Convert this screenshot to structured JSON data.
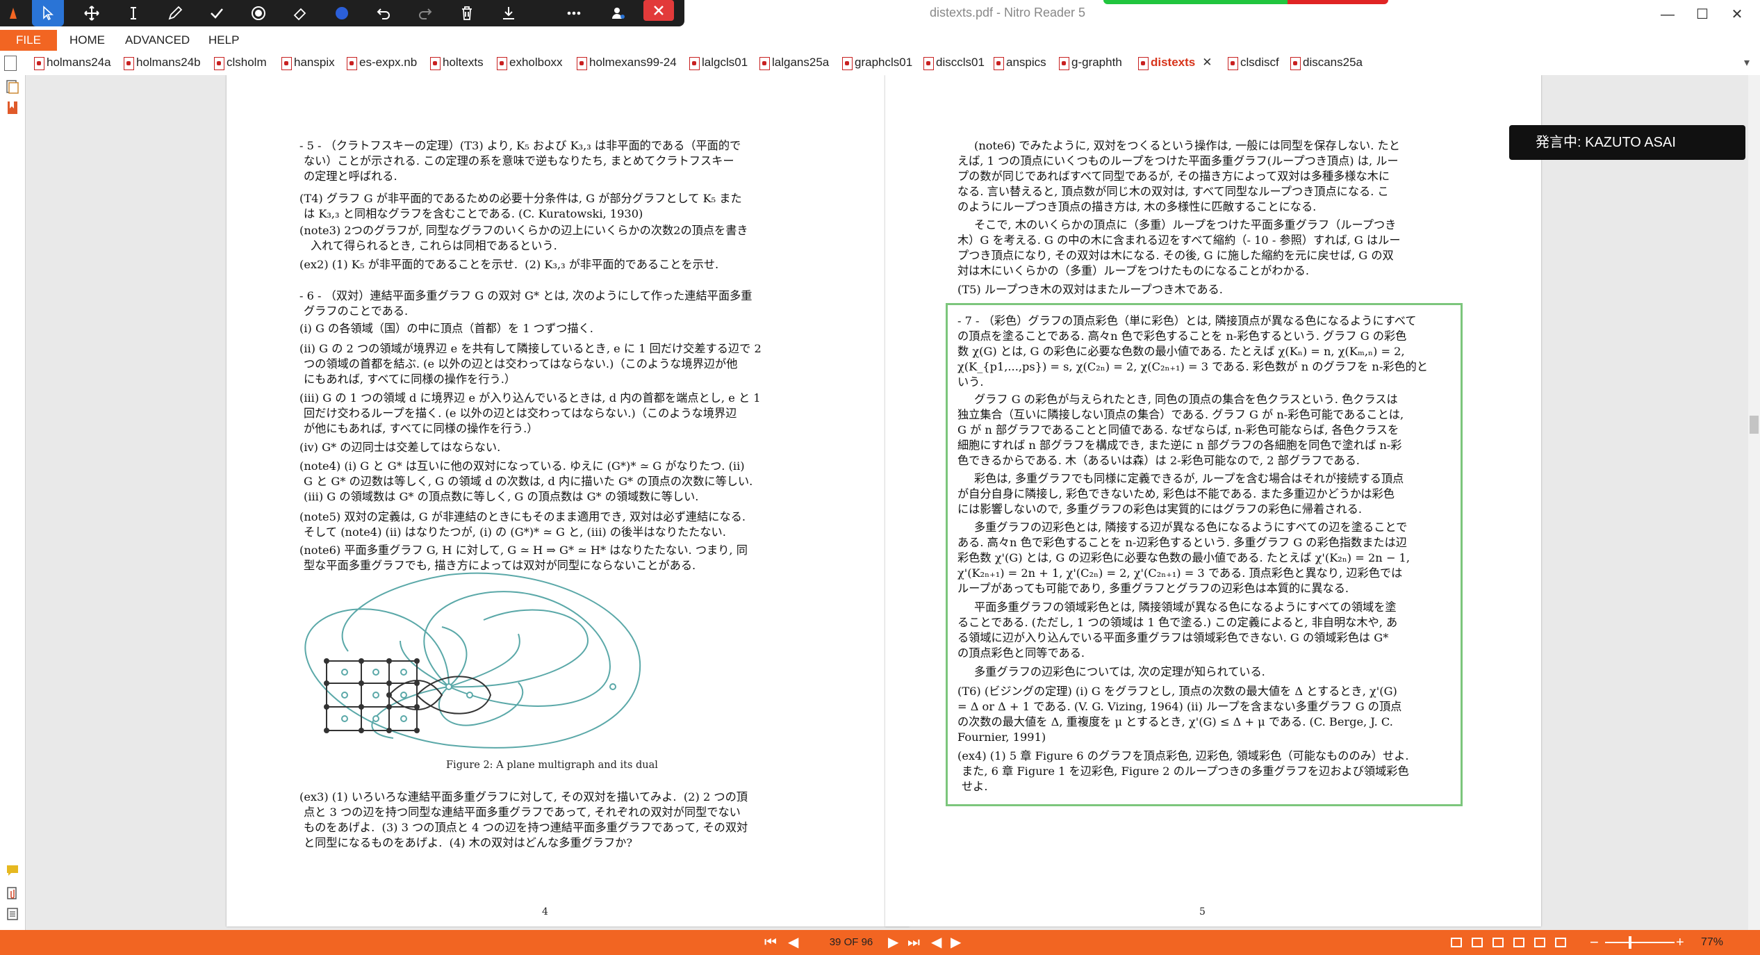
{
  "window": {
    "title": "distexts.pdf - Nitro Reader 5",
    "minimize": "—",
    "maximize": "☐",
    "close": "✕"
  },
  "ribbon": {
    "file": "FILE",
    "home": "HOME",
    "advanced": "ADVANCED",
    "help": "HELP"
  },
  "doc_tabs": [
    {
      "label": "holmans24a"
    },
    {
      "label": "holmans24b"
    },
    {
      "label": "clsholm"
    },
    {
      "label": "hanspix"
    },
    {
      "label": "es-expx.nb"
    },
    {
      "label": "holtexts"
    },
    {
      "label": "exholboxx"
    },
    {
      "label": "holmexans99-24"
    },
    {
      "label": "lalgcls01"
    },
    {
      "label": "lalgans25a"
    },
    {
      "label": "graphcls01"
    },
    {
      "label": "disccls01"
    },
    {
      "label": "anspics"
    },
    {
      "label": "g-graphth"
    },
    {
      "label": "distexts",
      "active": true
    },
    {
      "label": "clsdiscf"
    },
    {
      "label": "discans25a"
    }
  ],
  "speaking_overlay": "発言中: KAZUTO ASAI",
  "page4": {
    "lines": [
      "- 5 - （クラトフスキーの定理）(T3) より, K₅ および K₃,₃ は非平面的である（平面的で",
      "ない）ことが示される. この定理の系を意味で逆もなりたち, まとめてクラトフスキー",
      "の定理と呼ばれる.",
      "(T4) グラフ G が非平面的であるための必要十分条件は, G が部分グラフとして K₅ また",
      "は K₃,₃ と同相なグラフを含むことである. (C. Kuratowski, 1930)",
      "(note3) 2つのグラフが, 同型なグラフのいくらかの辺上にいくらかの次数2の頂点を書き",
      "入れて得られるとき, これらは同相であるという.",
      "(ex2) (1) K₅ が非平面的であることを示せ.  (2) K₃,₃ が非平面的であることを示せ.",
      "- 6 - （双対）連結平面多重グラフ G の双対 G* とは, 次のようにして作った連結平面多重",
      "グラフのことである.",
      "(i) G の各領域（国）の中に頂点（首都）を 1 つずつ描く.",
      "(ii) G の 2 つの領域が境界辺 e を共有して隣接しているとき, e に 1 回だけ交差する辺で 2",
      "つの領域の首都を結ぶ. (e 以外の辺とは交わってはならない.)（このような境界辺が他",
      "にもあれば, すべてに同様の操作を行う.）",
      "(iii) G の 1 つの領域 d に境界辺 e が入り込んでいるときは, d 内の首都を端点とし, e と 1",
      "回だけ交わるループを描く. (e 以外の辺とは交わってはならない.)（このような境界辺",
      "が他にもあれば, すべてに同様の操作を行う.）",
      "(iv) G* の辺同士は交差してはならない.",
      "(note4) (i) G と G* は互いに他の双対になっている. ゆえに (G*)* ≃ G がなりたつ. (ii)",
      "G と G* の辺数は等しく, G の領域 d の次数は, d 内に描いた G* の頂点の次数に等しい.",
      "(iii) G の領域数は G* の頂点数に等しく, G の頂点数は G* の領域数に等しい.",
      "(note5) 双対の定義は, G が非連結のときにもそのまま適用でき, 双対は必ず連結になる.",
      "そして (note4) (ii) はなりたつが, (i) の (G*)* ≃ G と, (iii) の後半はなりたたない.",
      "(note6) 平面多重グラフ G, H に対して, G ≃ H ⇒ G* ≃ H* はなりたたない. つまり, 同",
      "型な平面多重グラフでも, 描き方によっては双対が同型にならないことがある.",
      "(ex3) (1) いろいろな連結平面多重グラフに対して, その双対を描いてみよ.  (2) 2 つの頂",
      "点と 3 つの辺を持つ同型な連結平面多重グラフであって, それぞれの双対が同型でない",
      "ものをあげよ.  (3) 3 つの頂点と 4 つの辺を持つ連結平面多重グラフであって, その双対",
      "と同型になるものをあげよ.  (4) 木の双対はどんな多重グラフか?"
    ],
    "figure_caption": "Figure 2: A plane multigraph and its dual",
    "page_number": "4"
  },
  "page5": {
    "lines": [
      "(note6) でみたように, 双対をつくるという操作は, 一般には同型を保存しない. たと",
      "えば, 1 つの頂点にいくつものループをつけた平面多重グラフ(ループつき頂点) は, ルー",
      "プの数が同じであればすべて同型であるが, その描き方によって双対は多種多様な木に",
      "なる. 言い替えると, 頂点数が同じ木の双対は, すべて同型なループつき頂点になる. こ",
      "のようにループつき頂点の描き方は, 木の多様性に匹敵することになる.",
      "そこで, 木のいくらかの頂点に（多重）ループをつけた平面多重グラフ（ループつき",
      "木）G を考える. G の中の木に含まれる辺をすべて縮約（- 10 - 参照）すれば, G はルー",
      "プつき頂点になり, その双対は木になる. その後, G に施した縮約を元に戻せば, G の双",
      "対は木にいくらかの（多重）ループをつけたものになることがわかる.",
      "(T5) ループつき木の双対はまたループつき木である.",
      "- 7 - （彩色）グラフの頂点彩色（単に彩色）とは, 隣接頂点が異なる色になるようにすべて",
      "の頂点を塗ることである. 高々n 色で彩色することを n-彩色するという. グラフ G の彩色",
      "数 χ(G) とは, G の彩色に必要な色数の最小値である. たとえば χ(Kₙ) = n, χ(Kₘ,ₙ) = 2,",
      "χ(K_{p1,...,ps}) = s, χ(C₂ₙ) = 2, χ(C₂ₙ₊₁) = 3 である. 彩色数が n のグラフを n-彩色的と",
      "いう.",
      "グラフ G の彩色が与えられたとき, 同色の頂点の集合を色クラスという. 色クラスは",
      "独立集合（互いに隣接しない頂点の集合）である. グラフ G が n-彩色可能であることは,",
      "G が n 部グラフであることと同値である. なぜならば, n-彩色可能ならば, 各色クラスを",
      "細胞にすれば n 部グラフを構成でき, また逆に n 部グラフの各細胞を同色で塗れば n-彩",
      "色できるからである. 木（あるいは森）は 2-彩色可能なので, 2 部グラフである.",
      "彩色は, 多重グラフでも同様に定義できるが, ループを含む場合はそれが接続する頂点",
      "が自分自身に隣接し, 彩色できないため, 彩色は不能である. また多重辺かどうかは彩色",
      "には影響しないので, 多重グラフの彩色は実質的にはグラフの彩色に帰着される.",
      "多重グラフの辺彩色とは, 隣接する辺が異なる色になるようにすべての辺を塗ることで",
      "ある. 高々n 色で彩色することを n-辺彩色するという. 多重グラフ G の彩色指数または辺",
      "彩色数 χ'(G) とは, G の辺彩色に必要な色数の最小値である. たとえば χ'(K₂ₙ) = 2n − 1,",
      "χ'(K₂ₙ₊₁) = 2n + 1, χ'(C₂ₙ) = 2, χ'(C₂ₙ₊₁) = 3 である. 頂点彩色と異なり, 辺彩色では",
      "ループがあっても可能であり, 多重グラフとグラフの辺彩色は本質的に異なる.",
      "平面多重グラフの領域彩色とは, 隣接領域が異なる色になるようにすべての領域を塗",
      "ることである. (ただし, 1 つの領域は 1 色で塗る.) この定義によると, 非自明な木や, あ",
      "る領域に辺が入り込んでいる平面多重グラフは領域彩色できない. G の領域彩色は G*",
      "の頂点彩色と同等である.",
      "多重グラフの辺彩色については, 次の定理が知られている.",
      "(T6) (ビジングの定理) (i) G をグラフとし, 頂点の次数の最大値を Δ とするとき, χ'(G)",
      "= Δ or Δ + 1 である. (V. G. Vizing, 1964) (ii) ループを含まない多重グラフ G の頂点",
      "の次数の最大値を Δ, 重複度を μ とするとき, χ'(G) ≤ Δ + μ である. (C. Berge, J. C.",
      "Fournier, 1991)",
      "(ex4) (1) 5 章 Figure 6 のグラフを頂点彩色, 辺彩色, 領域彩色（可能なもののみ）せよ.",
      "また, 6 章 Figure 1 を辺彩色, Figure 2 のループつきの多重グラフを辺および領域彩色",
      "せよ."
    ],
    "page_number": "5"
  },
  "statusbar": {
    "page_indicator": "39 OF 96",
    "zoom": "77%",
    "zoom_minus": "−",
    "zoom_plus": "+"
  },
  "colors": {
    "accent": "#f26522",
    "toolbar_bg": "#1f1f1f",
    "select_tool": "#2a74d6",
    "highlight_box": "#7cc67c",
    "figure_dual_edges": "#5aa8a8"
  }
}
